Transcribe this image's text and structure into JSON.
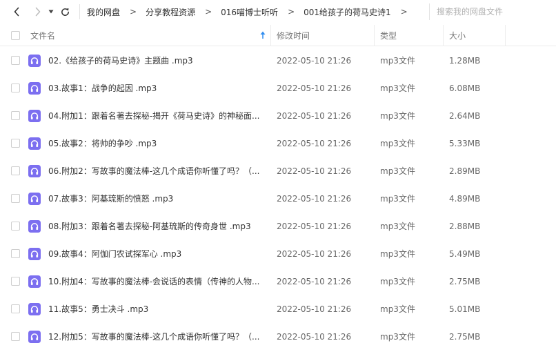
{
  "nav": {
    "back_icon": "chevron-left-icon",
    "forward_icon": "chevron-right-icon",
    "history_icon": "caret-down-icon",
    "refresh_icon": "refresh-icon"
  },
  "breadcrumb": [
    {
      "label": "我的网盘"
    },
    {
      "label": "分享教程资源"
    },
    {
      "label": "016喵博士听听"
    },
    {
      "label": "001给孩子的荷马史诗1"
    }
  ],
  "breadcrumb_separator": ">",
  "search": {
    "placeholder": "搜索我的网盘文件",
    "value": ""
  },
  "columns": {
    "name": "文件名",
    "modified": "修改时间",
    "type": "类型",
    "size": "大小",
    "sort_indicator": "arrow-up-icon"
  },
  "colors": {
    "file_icon": "#7c6ff0",
    "sort_arrow": "#2f8cf0"
  },
  "files": [
    {
      "name": "02.《给孩子的荷马史诗》主题曲 .mp3",
      "modified": "2022-05-10 21:26",
      "type": "mp3文件",
      "size": "1.28MB",
      "icon": "audio-file-icon"
    },
    {
      "name": "03.故事1：战争的起因 .mp3",
      "modified": "2022-05-10 21:26",
      "type": "mp3文件",
      "size": "6.08MB",
      "icon": "audio-file-icon"
    },
    {
      "name": "04.附加1：跟着名著去探秘-揭开《荷马史诗》的神秘面...",
      "modified": "2022-05-10 21:26",
      "type": "mp3文件",
      "size": "2.64MB",
      "icon": "audio-file-icon"
    },
    {
      "name": "05.故事2：将帅的争吵 .mp3",
      "modified": "2022-05-10 21:26",
      "type": "mp3文件",
      "size": "5.33MB",
      "icon": "audio-file-icon"
    },
    {
      "name": "06.附加2：写故事的魔法棒-这几个成语你听懂了吗？（...",
      "modified": "2022-05-10 21:26",
      "type": "mp3文件",
      "size": "2.89MB",
      "icon": "audio-file-icon"
    },
    {
      "name": "07.故事3：阿基琉斯的愤怒 .mp3",
      "modified": "2022-05-10 21:26",
      "type": "mp3文件",
      "size": "4.89MB",
      "icon": "audio-file-icon"
    },
    {
      "name": "08.附加3：跟着名著去探秘-阿基琉斯的传奇身世 .mp3",
      "modified": "2022-05-10 21:26",
      "type": "mp3文件",
      "size": "2.88MB",
      "icon": "audio-file-icon"
    },
    {
      "name": "09.故事4：阿伽门农试探军心 .mp3",
      "modified": "2022-05-10 21:26",
      "type": "mp3文件",
      "size": "5.49MB",
      "icon": "audio-file-icon"
    },
    {
      "name": "10.附加4：写故事的魔法棒-会说话的表情（传神的人物...",
      "modified": "2022-05-10 21:26",
      "type": "mp3文件",
      "size": "2.75MB",
      "icon": "audio-file-icon"
    },
    {
      "name": "11.故事5：勇士决斗 .mp3",
      "modified": "2022-05-10 21:26",
      "type": "mp3文件",
      "size": "5.01MB",
      "icon": "audio-file-icon"
    },
    {
      "name": "12.附加5：写故事的魔法棒-这几个成语你听懂了吗？（...",
      "modified": "2022-05-10 21:26",
      "type": "mp3文件",
      "size": "2.75MB",
      "icon": "audio-file-icon"
    }
  ]
}
